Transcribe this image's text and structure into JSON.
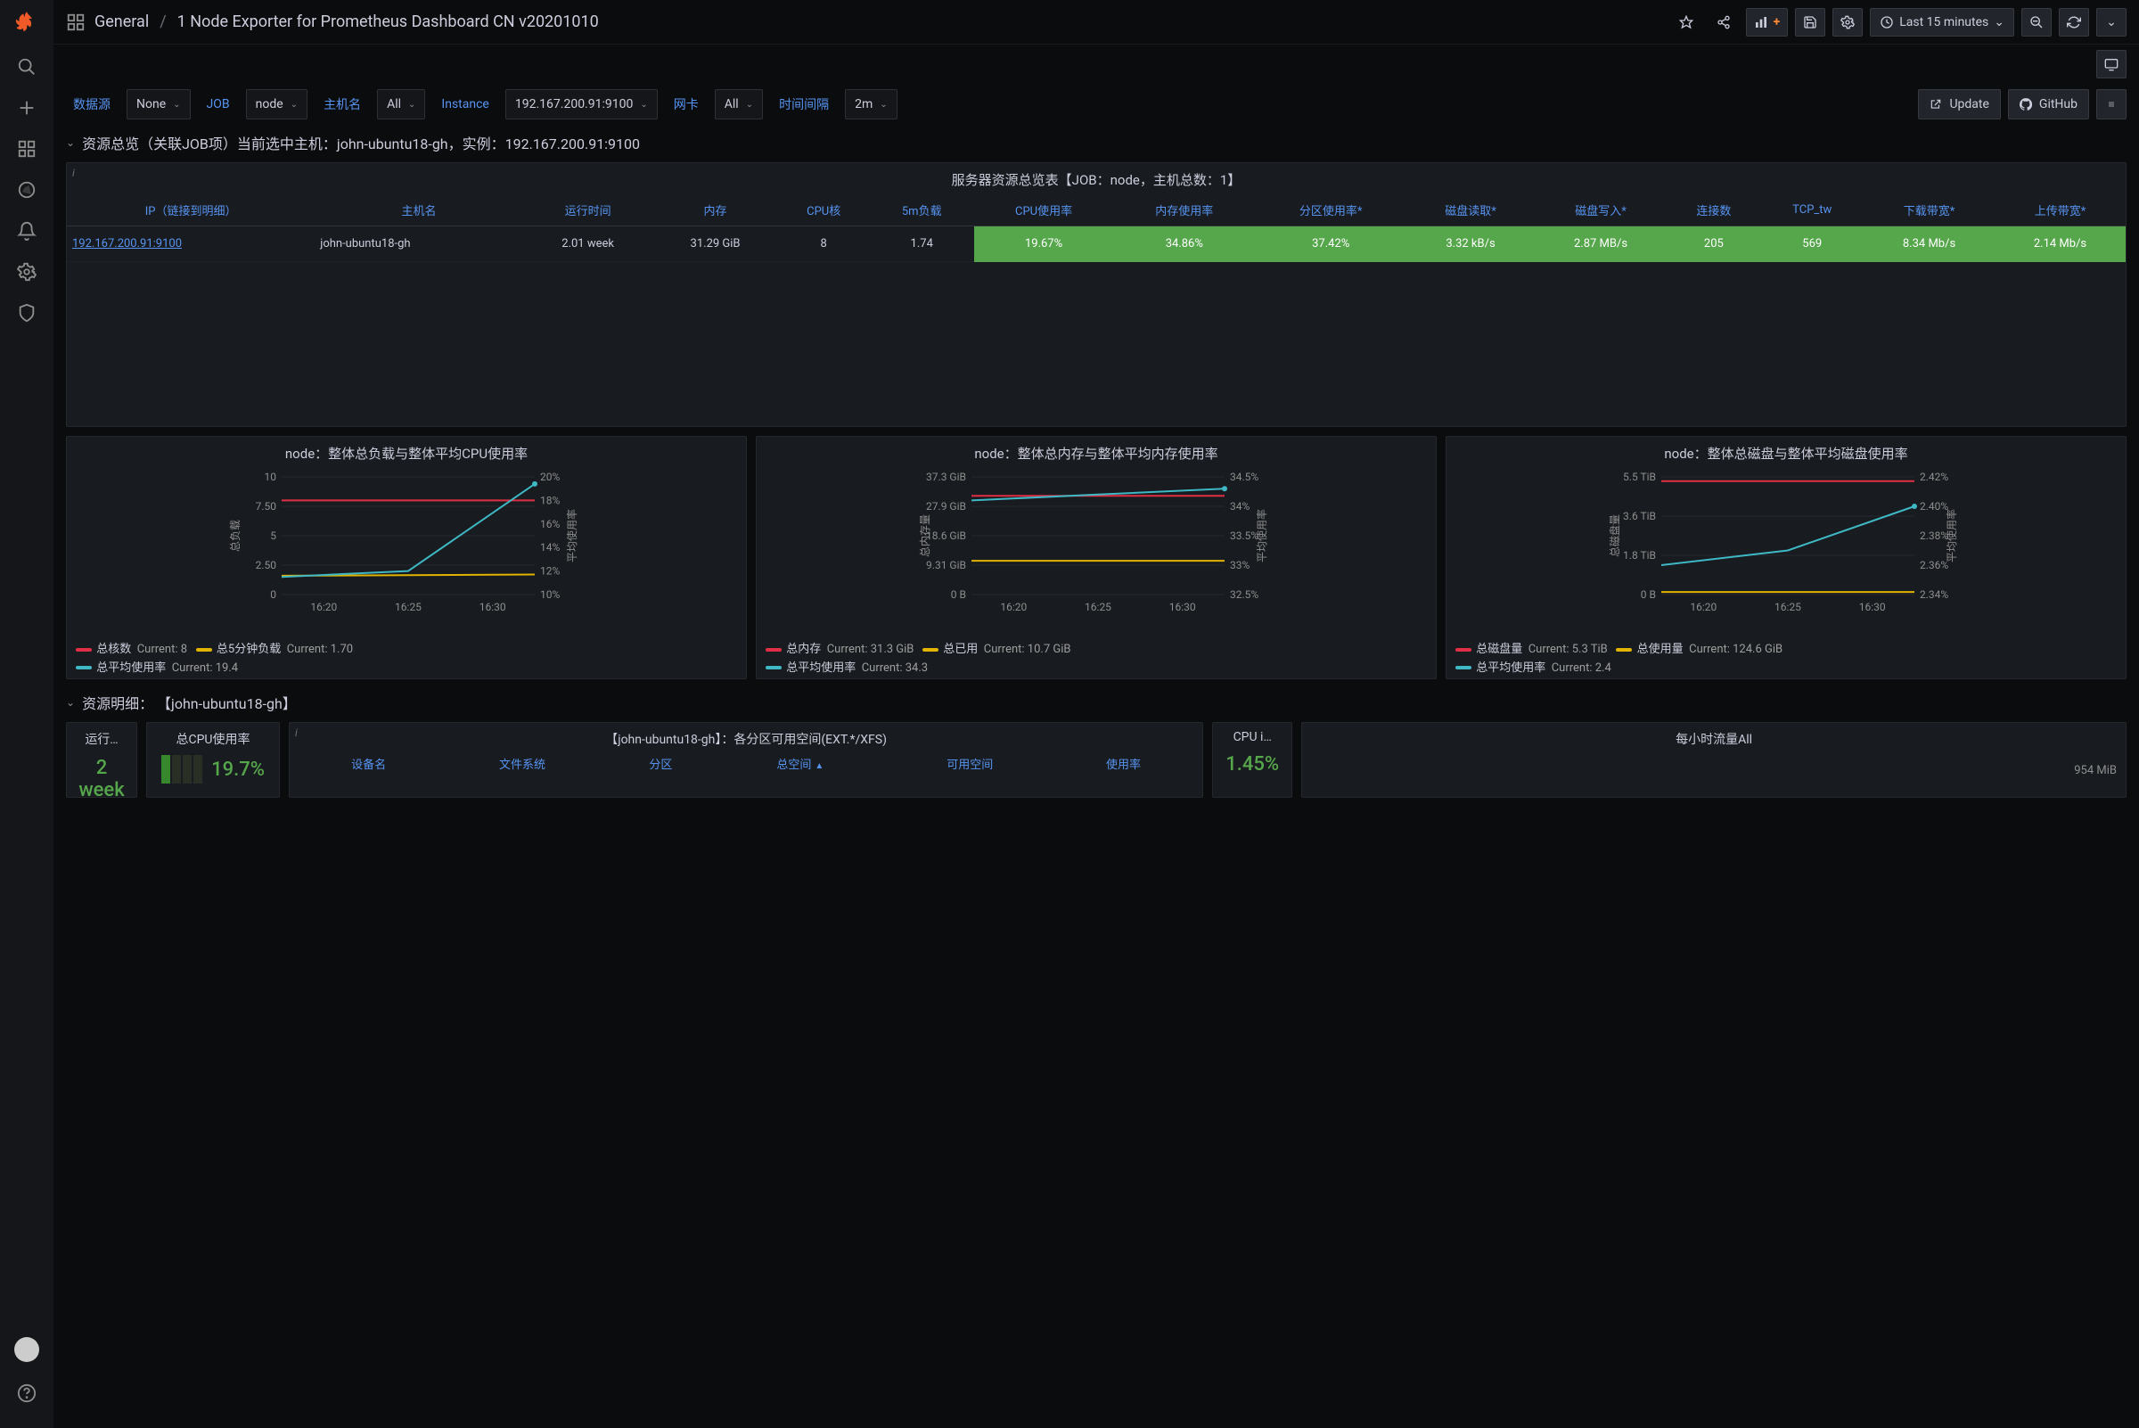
{
  "breadcrumb": {
    "folder": "General",
    "dashboard": "1 Node Exporter for Prometheus Dashboard CN v20201010"
  },
  "time_picker": {
    "label": "Last 15 minutes"
  },
  "variables": {
    "datasource_label": "数据源",
    "datasource_value": "None",
    "job_label": "JOB",
    "job_value": "node",
    "host_label": "主机名",
    "host_value": "All",
    "instance_label": "Instance",
    "instance_value": "192.167.200.91:9100",
    "nic_label": "网卡",
    "nic_value": "All",
    "interval_label": "时间间隔",
    "interval_value": "2m"
  },
  "links": {
    "update": "Update",
    "github": "GitHub"
  },
  "row1_title": "资源总览（关联JOB项）当前选中主机：john-ubuntu18-gh，实例：192.167.200.91:9100",
  "overview_table": {
    "title": "服务器资源总览表【JOB：node，主机总数：1】",
    "headers": [
      "IP（链接到明细）",
      "主机名",
      "运行时间",
      "内存",
      "CPU核",
      "5m负载",
      "CPU使用率",
      "内存使用率",
      "分区使用率*",
      "磁盘读取*",
      "磁盘写入*",
      "连接数",
      "TCP_tw",
      "下载带宽*",
      "上传带宽*"
    ],
    "row": {
      "ip": "192.167.200.91:9100",
      "host": "john-ubuntu18-gh",
      "uptime": "2.01 week",
      "mem": "31.29 GiB",
      "cores": "8",
      "load5": "1.74",
      "cpu_pct": "19.67%",
      "mem_pct": "34.86%",
      "disk_pct": "37.42%",
      "read": "3.32 kB/s",
      "write": "2.87 MB/s",
      "conn": "205",
      "tcp_tw": "569",
      "down": "8.34 Mb/s",
      "up": "2.14 Mb/s"
    }
  },
  "charts": [
    {
      "title": "node：整体总负载与整体平均CPU使用率",
      "left_axis": [
        "10",
        "7.50",
        "5",
        "2.50",
        "0"
      ],
      "right_axis": [
        "20%",
        "18%",
        "16%",
        "14%",
        "12%",
        "10%"
      ],
      "x_ticks": [
        "16:20",
        "16:25",
        "16:30"
      ],
      "left_label": "总负载",
      "right_label": "平均使用率",
      "legend": [
        {
          "color": "#e02f44",
          "name": "总核数",
          "stat": "Current: 8"
        },
        {
          "color": "#e0b400",
          "name": "总5分钟负载",
          "stat": "Current: 1.70"
        },
        {
          "color": "#3eb8c5",
          "name": "总平均使用率",
          "stat": "Current: 19.4"
        }
      ]
    },
    {
      "title": "node：整体总内存与整体平均内存使用率",
      "left_axis": [
        "37.3 GiB",
        "27.9 GiB",
        "18.6 GiB",
        "9.31 GiB",
        "0 B"
      ],
      "right_axis": [
        "34.5%",
        "34%",
        "33.5%",
        "33%",
        "32.5%"
      ],
      "x_ticks": [
        "16:20",
        "16:25",
        "16:30"
      ],
      "left_label": "总内存量",
      "right_label": "平均使用率",
      "legend": [
        {
          "color": "#e02f44",
          "name": "总内存",
          "stat": "Current: 31.3 GiB"
        },
        {
          "color": "#e0b400",
          "name": "总已用",
          "stat": "Current: 10.7 GiB"
        },
        {
          "color": "#3eb8c5",
          "name": "总平均使用率",
          "stat": "Current: 34.3"
        }
      ]
    },
    {
      "title": "node：整体总磁盘与整体平均磁盘使用率",
      "left_axis": [
        "5.5 TiB",
        "3.6 TiB",
        "1.8 TiB",
        "0 B"
      ],
      "right_axis": [
        "2.42%",
        "2.40%",
        "2.38%",
        "2.36%",
        "2.34%"
      ],
      "x_ticks": [
        "16:20",
        "16:25",
        "16:30"
      ],
      "left_label": "总磁盘量",
      "right_label": "平均使用率",
      "legend": [
        {
          "color": "#e02f44",
          "name": "总磁盘量",
          "stat": "Current: 5.3 TiB"
        },
        {
          "color": "#e0b400",
          "name": "总使用量",
          "stat": "Current: 124.6 GiB"
        },
        {
          "color": "#3eb8c5",
          "name": "总平均使用率",
          "stat": "Current: 2.4"
        }
      ]
    }
  ],
  "chart_data": [
    {
      "type": "line",
      "title": "node：整体总负载与整体平均CPU使用率",
      "x": [
        "16:20",
        "16:25",
        "16:30"
      ],
      "series": [
        {
          "name": "总核数",
          "axis": "left",
          "values": [
            8,
            8,
            8
          ]
        },
        {
          "name": "总5分钟负载",
          "axis": "left",
          "values": [
            1.6,
            1.65,
            1.7
          ]
        },
        {
          "name": "总平均使用率",
          "axis": "right",
          "values": [
            11.5,
            12.0,
            19.4
          ]
        }
      ],
      "ylim_left": [
        0,
        10
      ],
      "ylim_right": [
        10,
        20
      ],
      "ylabel_left": "总负载",
      "ylabel_right": "平均使用率"
    },
    {
      "type": "line",
      "title": "node：整体总内存与整体平均内存使用率",
      "x": [
        "16:20",
        "16:25",
        "16:30"
      ],
      "series": [
        {
          "name": "总内存",
          "axis": "left",
          "values": [
            31.3,
            31.3,
            31.3
          ]
        },
        {
          "name": "总已用",
          "axis": "left",
          "values": [
            10.7,
            10.7,
            10.7
          ]
        },
        {
          "name": "总平均使用率",
          "axis": "right",
          "values": [
            34.1,
            34.2,
            34.3
          ]
        }
      ],
      "ylim_left": [
        0,
        37.3
      ],
      "ylim_right": [
        32.5,
        34.5
      ],
      "ylabel_left": "总内存量",
      "ylabel_right": "平均使用率",
      "unit_left": "GiB"
    },
    {
      "type": "line",
      "title": "node：整体总磁盘与整体平均磁盘使用率",
      "x": [
        "16:20",
        "16:25",
        "16:30"
      ],
      "series": [
        {
          "name": "总磁盘量",
          "axis": "left",
          "values": [
            5.3,
            5.3,
            5.3
          ]
        },
        {
          "name": "总使用量",
          "axis": "left",
          "values": [
            0.12,
            0.12,
            0.12
          ]
        },
        {
          "name": "总平均使用率",
          "axis": "right",
          "values": [
            2.36,
            2.37,
            2.4
          ]
        }
      ],
      "ylim_left": [
        0,
        5.5
      ],
      "ylim_right": [
        2.34,
        2.42
      ],
      "ylabel_left": "总磁盘量",
      "ylabel_right": "平均使用率",
      "unit_left": "TiB"
    }
  ],
  "row2_title": "资源明细： 【john-ubuntu18-gh】",
  "detail": {
    "uptime_title": "运行…",
    "uptime_value": "2 week",
    "cpu_title": "总CPU使用率",
    "cpu_value": "19.7%",
    "partitions_title": "【john-ubuntu18-gh】：各分区可用空间(EXT.*/XFS)",
    "partitions_headers": [
      "设备名",
      "文件系统",
      "分区",
      "总空间",
      "可用空间",
      "使用率"
    ],
    "cpui_title": "CPU i…",
    "cpui_value": "1.45%",
    "hourly_title": "每小时流量All",
    "hourly_value": "954 MiB"
  }
}
